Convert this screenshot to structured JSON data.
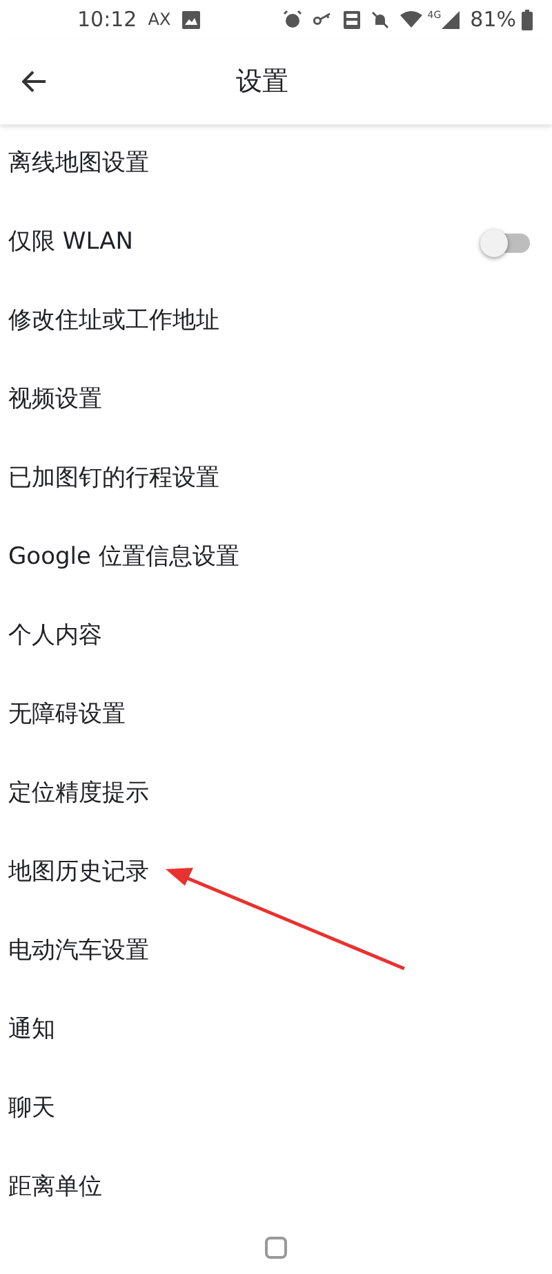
{
  "status_bar": {
    "time": "10:12",
    "carrier": "AX",
    "battery": "81%",
    "network": "4G"
  },
  "header": {
    "title": "设置"
  },
  "items": [
    {
      "label": "离线地图设置",
      "kind": "plain",
      "annotated": false
    },
    {
      "label": "仅限 WLAN",
      "kind": "toggle",
      "on": false,
      "annotated": false
    },
    {
      "label": "修改住址或工作地址",
      "kind": "plain",
      "annotated": false
    },
    {
      "label": "视频设置",
      "kind": "plain",
      "annotated": false
    },
    {
      "label": "已加图钉的行程设置",
      "kind": "plain",
      "annotated": false
    },
    {
      "label": "Google 位置信息设置",
      "kind": "plain",
      "annotated": false
    },
    {
      "label": "个人内容",
      "kind": "plain",
      "annotated": false
    },
    {
      "label": "无障碍设置",
      "kind": "plain",
      "annotated": false
    },
    {
      "label": "定位精度提示",
      "kind": "plain",
      "annotated": false
    },
    {
      "label": "地图历史记录",
      "kind": "plain",
      "annotated": true
    },
    {
      "label": "电动汽车设置",
      "kind": "plain",
      "annotated": false
    },
    {
      "label": "通知",
      "kind": "plain",
      "annotated": false
    },
    {
      "label": "聊天",
      "kind": "plain",
      "annotated": false
    },
    {
      "label": "距离单位",
      "kind": "plain",
      "annotated": false
    }
  ]
}
